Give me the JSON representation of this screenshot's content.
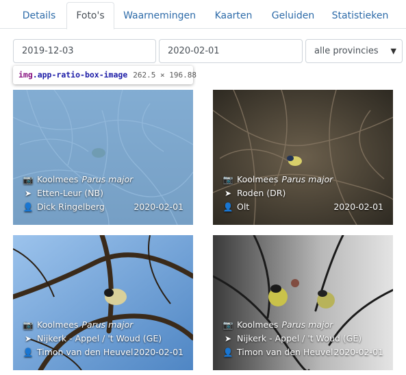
{
  "tabs": [
    {
      "label": "Details",
      "active": false
    },
    {
      "label": "Foto's",
      "active": true
    },
    {
      "label": "Waarnemingen",
      "active": false
    },
    {
      "label": "Kaarten",
      "active": false
    },
    {
      "label": "Geluiden",
      "active": false
    },
    {
      "label": "Statistieken",
      "active": false
    }
  ],
  "filters": {
    "date_from": "2019-12-03",
    "date_to": "2020-02-01",
    "province": "alle provincies"
  },
  "tooltip": {
    "tag": "img",
    "class_name": ".app-ratio-box-image",
    "dimensions": "262.5 × 196.88"
  },
  "photos": [
    {
      "species": "Koolmees",
      "scientific": "Parus major",
      "location": "Etten-Leur (NB)",
      "observer": "Dick Ringelberg",
      "date": "2020-02-01",
      "highlighted": true
    },
    {
      "species": "Koolmees",
      "scientific": "Parus major",
      "location": "Roden (DR)",
      "observer": "Olt",
      "date": "2020-02-01",
      "highlighted": false
    },
    {
      "species": "Koolmees",
      "scientific": "Parus major",
      "location": "Nijkerk - Appel / 't Woud (GE)",
      "observer": "Timon van den Heuvel",
      "date": "2020-02-01",
      "highlighted": false
    },
    {
      "species": "Koolmees",
      "scientific": "Parus major",
      "location": "Nijkerk - Appel / 't Woud (GE)",
      "observer": "Timon van den Heuvel",
      "date": "2020-02-01",
      "highlighted": false
    }
  ],
  "icons": {
    "camera": "camera-icon",
    "location": "location-arrow-icon",
    "user": "user-icon",
    "dropdown": "chevron-down-icon"
  },
  "colors": {
    "tab_link": "#2c6aa8",
    "highlight_overlay": "#6fa8dc",
    "tooltip_tag": "#881280",
    "tooltip_class": "#1a1aa6"
  }
}
